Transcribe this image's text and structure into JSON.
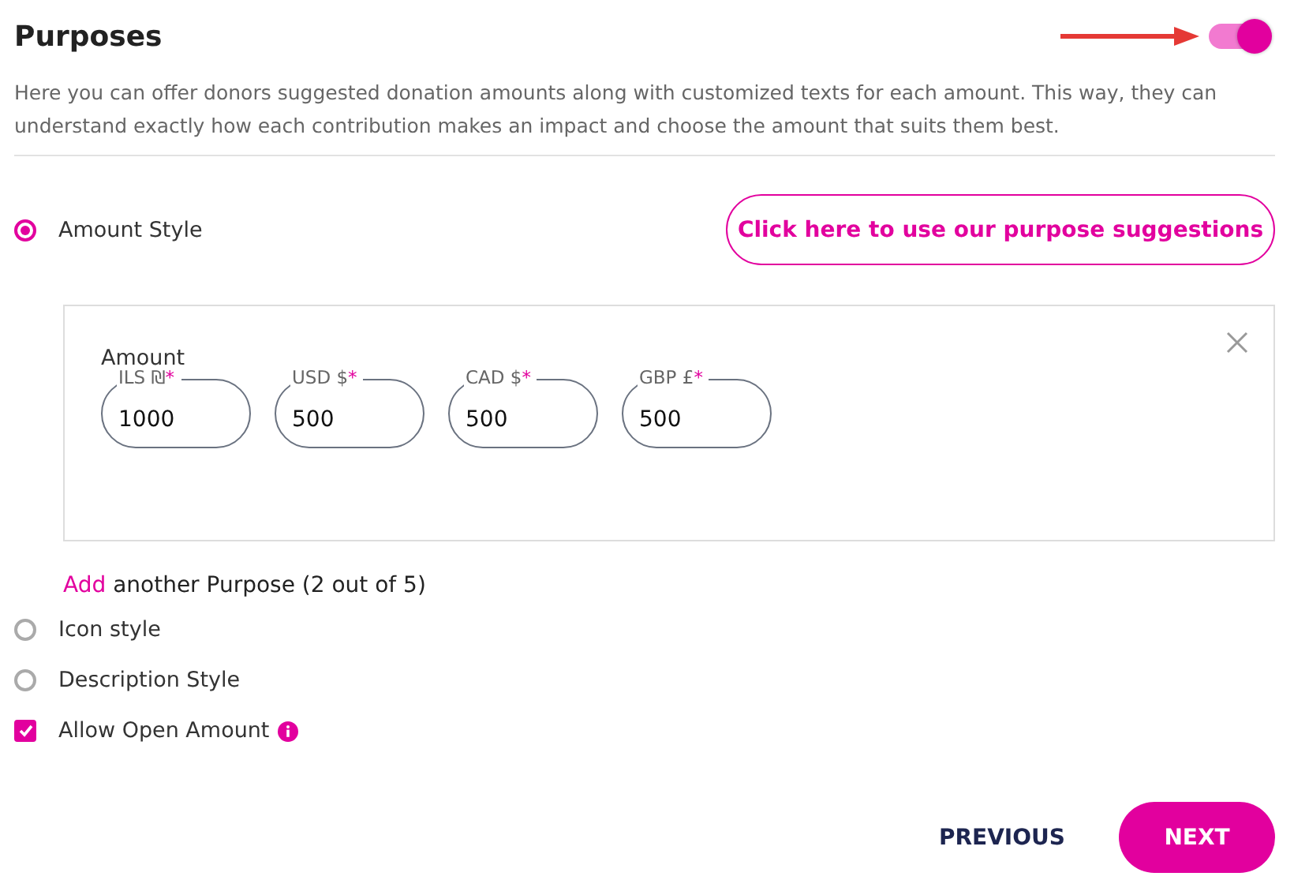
{
  "header": {
    "title": "Purposes",
    "toggle_on": true
  },
  "description": "Here you can offer donors suggested donation amounts along with customized texts for each amount. This way, they can understand exactly how each contribution makes an impact and choose the amount that suits them best.",
  "amount_style": {
    "label": "Amount Style",
    "selected": true
  },
  "suggestion_button": "Click here to use our purpose suggestions",
  "purpose_card": {
    "label": "Amount",
    "fields": [
      {
        "label": "ILS ₪",
        "required_mark": "*",
        "value": "1000"
      },
      {
        "label": "USD $",
        "required_mark": "*",
        "value": "500"
      },
      {
        "label": "CAD $",
        "required_mark": "*",
        "value": "500"
      },
      {
        "label": "GBP £",
        "required_mark": "*",
        "value": "500"
      }
    ]
  },
  "add_purpose": {
    "link": "Add",
    "text": "another Purpose (2 out of 5)"
  },
  "other_styles": [
    {
      "label": "Icon style",
      "selected": false
    },
    {
      "label": "Description Style",
      "selected": false
    }
  ],
  "allow_open_amount": {
    "label": "Allow Open Amount",
    "checked": true
  },
  "footer": {
    "previous": "PREVIOUS",
    "next": "NEXT"
  }
}
